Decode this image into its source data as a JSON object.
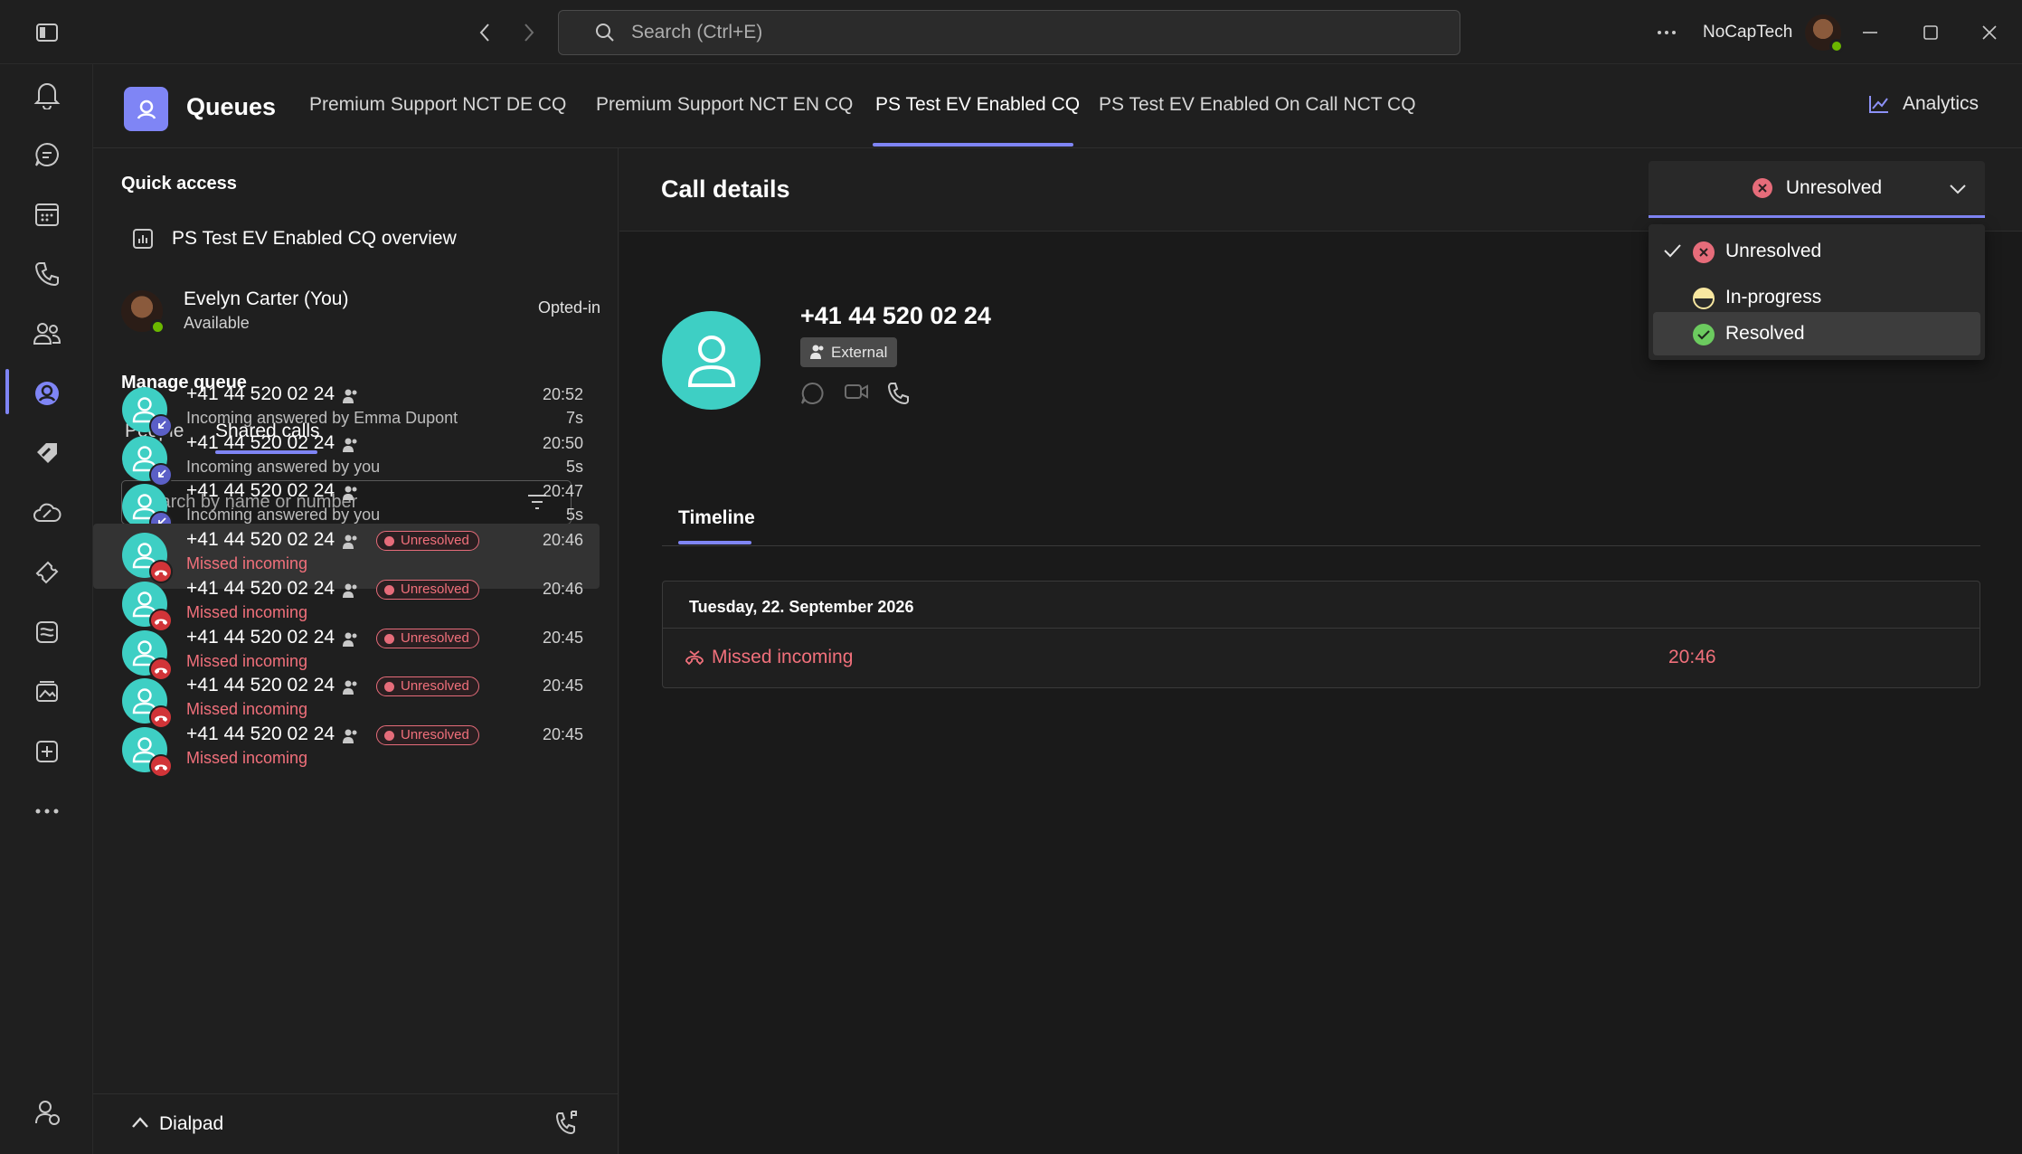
{
  "titlebar": {
    "search_placeholder": "Search (Ctrl+E)",
    "username": "NoCapTech"
  },
  "queues": {
    "title": "Queues",
    "tabs": [
      {
        "label": "Premium Support NCT DE CQ"
      },
      {
        "label": "Premium Support NCT EN CQ"
      },
      {
        "label": "PS Test EV Enabled CQ"
      },
      {
        "label": "PS Test EV Enabled On Call NCT CQ"
      }
    ],
    "active_tab": "PS Test EV Enabled CQ",
    "analytics": "Analytics"
  },
  "left": {
    "quick_access_title": "Quick access",
    "overview_label": "PS Test EV Enabled CQ overview",
    "user_name": "Evelyn Carter (You)",
    "user_status": "Available",
    "opted": "Opted-in",
    "manage_title": "Manage queue",
    "tab_people": "People",
    "tab_shared": "Shared calls",
    "search_placeholder": "Search by name or number",
    "calls": [
      {
        "number": "+41 44 520 02 24",
        "sub": "Incoming answered by Emma Dupont",
        "time": "20:52",
        "duration": "7s",
        "type": "answered"
      },
      {
        "number": "+41 44 520 02 24",
        "sub": "Incoming answered by you",
        "time": "20:50",
        "duration": "5s",
        "type": "answered"
      },
      {
        "number": "+41 44 520 02 24",
        "sub": "Incoming answered by you",
        "time": "20:47",
        "duration": "5s",
        "type": "answered"
      },
      {
        "number": "+41 44 520 02 24",
        "sub": "Missed incoming",
        "time": "20:46",
        "status": "Unresolved",
        "type": "missed",
        "selected": true
      },
      {
        "number": "+41 44 520 02 24",
        "sub": "Missed incoming",
        "time": "20:46",
        "status": "Unresolved",
        "type": "missed"
      },
      {
        "number": "+41 44 520 02 24",
        "sub": "Missed incoming",
        "time": "20:45",
        "status": "Unresolved",
        "type": "missed"
      },
      {
        "number": "+41 44 520 02 24",
        "sub": "Missed incoming",
        "time": "20:45",
        "status": "Unresolved",
        "type": "missed"
      },
      {
        "number": "+41 44 520 02 24",
        "sub": "Missed incoming",
        "time": "20:45",
        "status": "Unresolved",
        "type": "missed"
      }
    ],
    "dialpad": "Dialpad"
  },
  "details": {
    "title": "Call details",
    "status_selected": "Unresolved",
    "status_options": [
      {
        "label": "Unresolved",
        "checked": true,
        "color": "#e66c7a"
      },
      {
        "label": "In-progress",
        "checked": false,
        "color": "#f8e7a0"
      },
      {
        "label": "Resolved",
        "checked": false,
        "color": "#6ccb5f"
      }
    ],
    "phone": "+41 44 520 02 24",
    "external_tag": "External",
    "timeline_tab": "Timeline",
    "timeline_date": "Tuesday, 22. September 2026",
    "event_label": "Missed incoming",
    "event_time": "20:46"
  },
  "colors": {
    "accent": "#7f85f5",
    "missed": "#f1707b",
    "avatar": "#3ecfc4"
  }
}
